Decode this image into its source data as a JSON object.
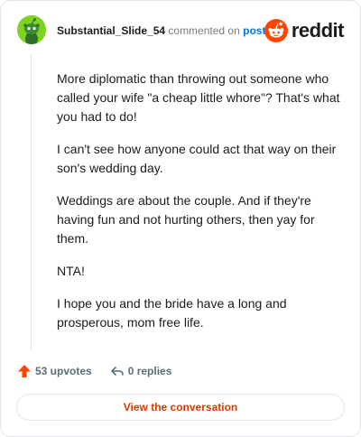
{
  "comment": {
    "username": "Substantial_Slide_54",
    "action_text": "commented on",
    "post_link": "post",
    "paragraphs": [
      "More diplomatic than throwing out someone who called your wife \"a cheap little whore\"? That's what you had to do!",
      "I can't see how anyone could act that way on their son's wedding day.",
      "Weddings are about the couple. And if they're having fun and not hurting others, then yay for them.",
      "NTA!",
      "I hope you and the bride have a long and prosperous, mom free life."
    ]
  },
  "brand": {
    "wordmark": "reddit",
    "color": "#ff4500"
  },
  "footer": {
    "upvotes": "53 upvotes",
    "replies": "0 replies",
    "view_button": "View the conversation"
  },
  "icons": {
    "avatar": "snoo-avatar-icon",
    "logo": "reddit-logo-icon",
    "upvote": "upvote-arrow-icon",
    "reply": "reply-arrow-icon"
  },
  "colors": {
    "avatar_bg": "#7ed321",
    "link": "#0079d3",
    "upvote": "#ff4500",
    "button_text": "#d93a00"
  }
}
